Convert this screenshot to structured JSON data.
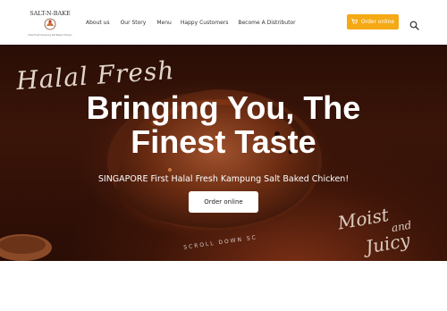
{
  "header": {
    "logo_text": "SALT-N-BAKE",
    "logo_tagline": "Halal Fresh Kampung Salt Baked Chicken",
    "nav": [
      {
        "label": "About us"
      },
      {
        "label": "Our Story"
      },
      {
        "label": "Menu"
      },
      {
        "label": "Happy Customers"
      },
      {
        "label": "Become A Distributor"
      }
    ],
    "order_button": "Order online",
    "icons": [
      "cart-icon",
      "search-icon"
    ]
  },
  "hero": {
    "script_left": "Halal Fresh",
    "title_line1": "Bringing You, The",
    "title_line2": "Finest Taste",
    "subtitle": "SINGAPORE First Halal Fresh Kampung Salt Baked Chicken!",
    "button": "Order online",
    "script_right_1": "Moist",
    "script_right_2": "and",
    "script_right_3": "Juicy",
    "scroll_hint": "SCROLL DOWN SC"
  },
  "colors": {
    "accent": "#f5a914",
    "hero_dark": "#3a1409",
    "text_white": "#ffffff"
  }
}
